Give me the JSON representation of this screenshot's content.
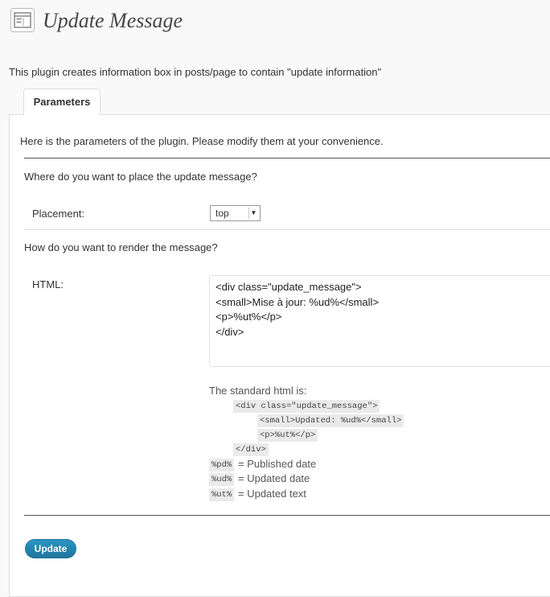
{
  "header": {
    "title": "Update Message",
    "icon": "page-layout-icon"
  },
  "intro": "This plugin creates information box in posts/page to contain \"update information\"",
  "tabs": [
    {
      "label": "Parameters"
    }
  ],
  "description": "Here is the parameters of the plugin. Please modify them at your convenience.",
  "placement_section": {
    "question": "Where do you want to place the update message?",
    "label": "Placement:",
    "selected": "top"
  },
  "render_section": {
    "question": "How do you want to render the message?",
    "label": "HTML:",
    "html_value": "<div class=\"update_message\">\n<small>Mise à jour: %ud%</small>\n<p>%ut%</p>\n</div>"
  },
  "standard": {
    "title": "The standard html is:",
    "lines": [
      "<div class=\"update_message\">",
      "<small>Updated: %ud%</small>",
      "<p>%ut%</p>",
      "</div>"
    ]
  },
  "legend": [
    {
      "code": "%pd%",
      "text": "= Published date"
    },
    {
      "code": "%ud%",
      "text": "= Updated date"
    },
    {
      "code": "%ut%",
      "text": "= Updated text"
    }
  ],
  "button": {
    "label": "Update"
  },
  "colors": {
    "accent": "#21759b"
  }
}
